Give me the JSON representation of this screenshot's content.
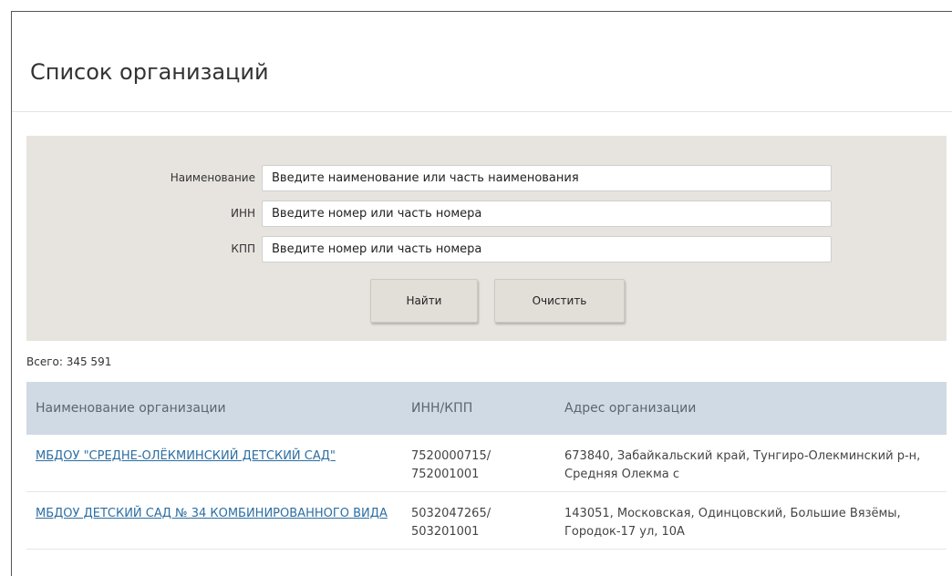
{
  "page": {
    "title": "Список организаций"
  },
  "filters": {
    "name": {
      "label": "Наименование",
      "placeholder": "Введите наименование или часть наименования"
    },
    "inn": {
      "label": "ИНН",
      "placeholder": "Введите номер или часть номера"
    },
    "kpp": {
      "label": "КПП",
      "placeholder": "Введите номер или часть номера"
    },
    "find_button": "Найти",
    "clear_button": "Очистить"
  },
  "summary": {
    "total_text": "Всего: 345 591"
  },
  "table": {
    "columns": [
      "Наименование организации",
      "ИНН/КПП",
      "Адрес организации"
    ],
    "rows": [
      {
        "name": "МБДОУ \"СРЕДНЕ-ОЛЁКМИНСКИЙ ДЕТСКИЙ САД\"",
        "inn": "7520000715/",
        "kpp": "752001001",
        "address": "673840, Забайкальский край, Тунгиро-Олекминский р-н, Средняя Олекма с"
      },
      {
        "name": "МБДОУ ДЕТСКИЙ САД № 34 КОМБИНИРОВАННОГО ВИДА",
        "inn": "5032047265/",
        "kpp": "503201001",
        "address": "143051, Московская, Одинцовский, Большие Вязёмы, Городок-17 ул, 10А"
      }
    ]
  }
}
